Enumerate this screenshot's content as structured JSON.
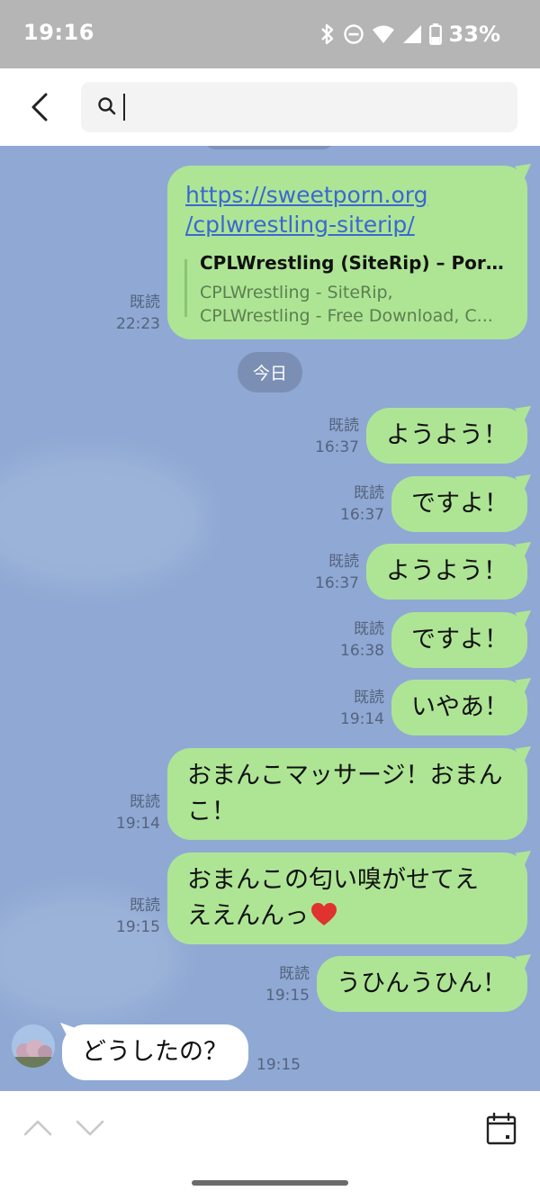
{
  "status_bar": {
    "time": "19:16",
    "battery": "33%"
  },
  "search": {
    "value": "",
    "placeholder": ""
  },
  "colors": {
    "chat_background": "#8fa9d4",
    "bubble_outgoing": "#aee595",
    "bubble_incoming": "#ffffff",
    "link": "#3a68d2"
  },
  "link_message": {
    "url_line1": "https://sweetporn.org",
    "url_line2": "/cplwrestling-siterip/",
    "preview_title": "CPLWrestling (SiteRip) – Porn...",
    "preview_desc_line1": "CPLWrestling - SiteRip,",
    "preview_desc_line2": "CPLWrestling - Free Download, C...",
    "read_label": "既読",
    "time": "22:23"
  },
  "date_separator": "今日",
  "messages": [
    {
      "text": "ようよう！",
      "read_label": "既読",
      "time": "16:37"
    },
    {
      "text": "ですよ！",
      "read_label": "既読",
      "time": "16:37"
    },
    {
      "text": "ようよう！",
      "read_label": "既読",
      "time": "16:37"
    },
    {
      "text": "ですよ！",
      "read_label": "既読",
      "time": "16:38"
    },
    {
      "text": "いやあ！",
      "read_label": "既読",
      "time": "19:14"
    },
    {
      "text_line1": "おまんこマッサージ！おまん",
      "text_line2": "こ！",
      "read_label": "既読",
      "time": "19:14"
    },
    {
      "text_line1": "おまんこの匂い嗅がせてえ",
      "text_line2": "ええんんっ",
      "emoji": "❤️",
      "read_label": "既読",
      "time": "19:15"
    },
    {
      "text": "うひんうひん！",
      "read_label": "既読",
      "time": "19:15"
    }
  ],
  "incoming_message": {
    "text": "どうしたの？",
    "time": "19:15"
  },
  "icons": {
    "back": "chevron-left-icon",
    "search": "search-icon",
    "nav_up": "chevron-up-icon",
    "nav_down": "chevron-down-icon",
    "calendar": "calendar-icon"
  }
}
